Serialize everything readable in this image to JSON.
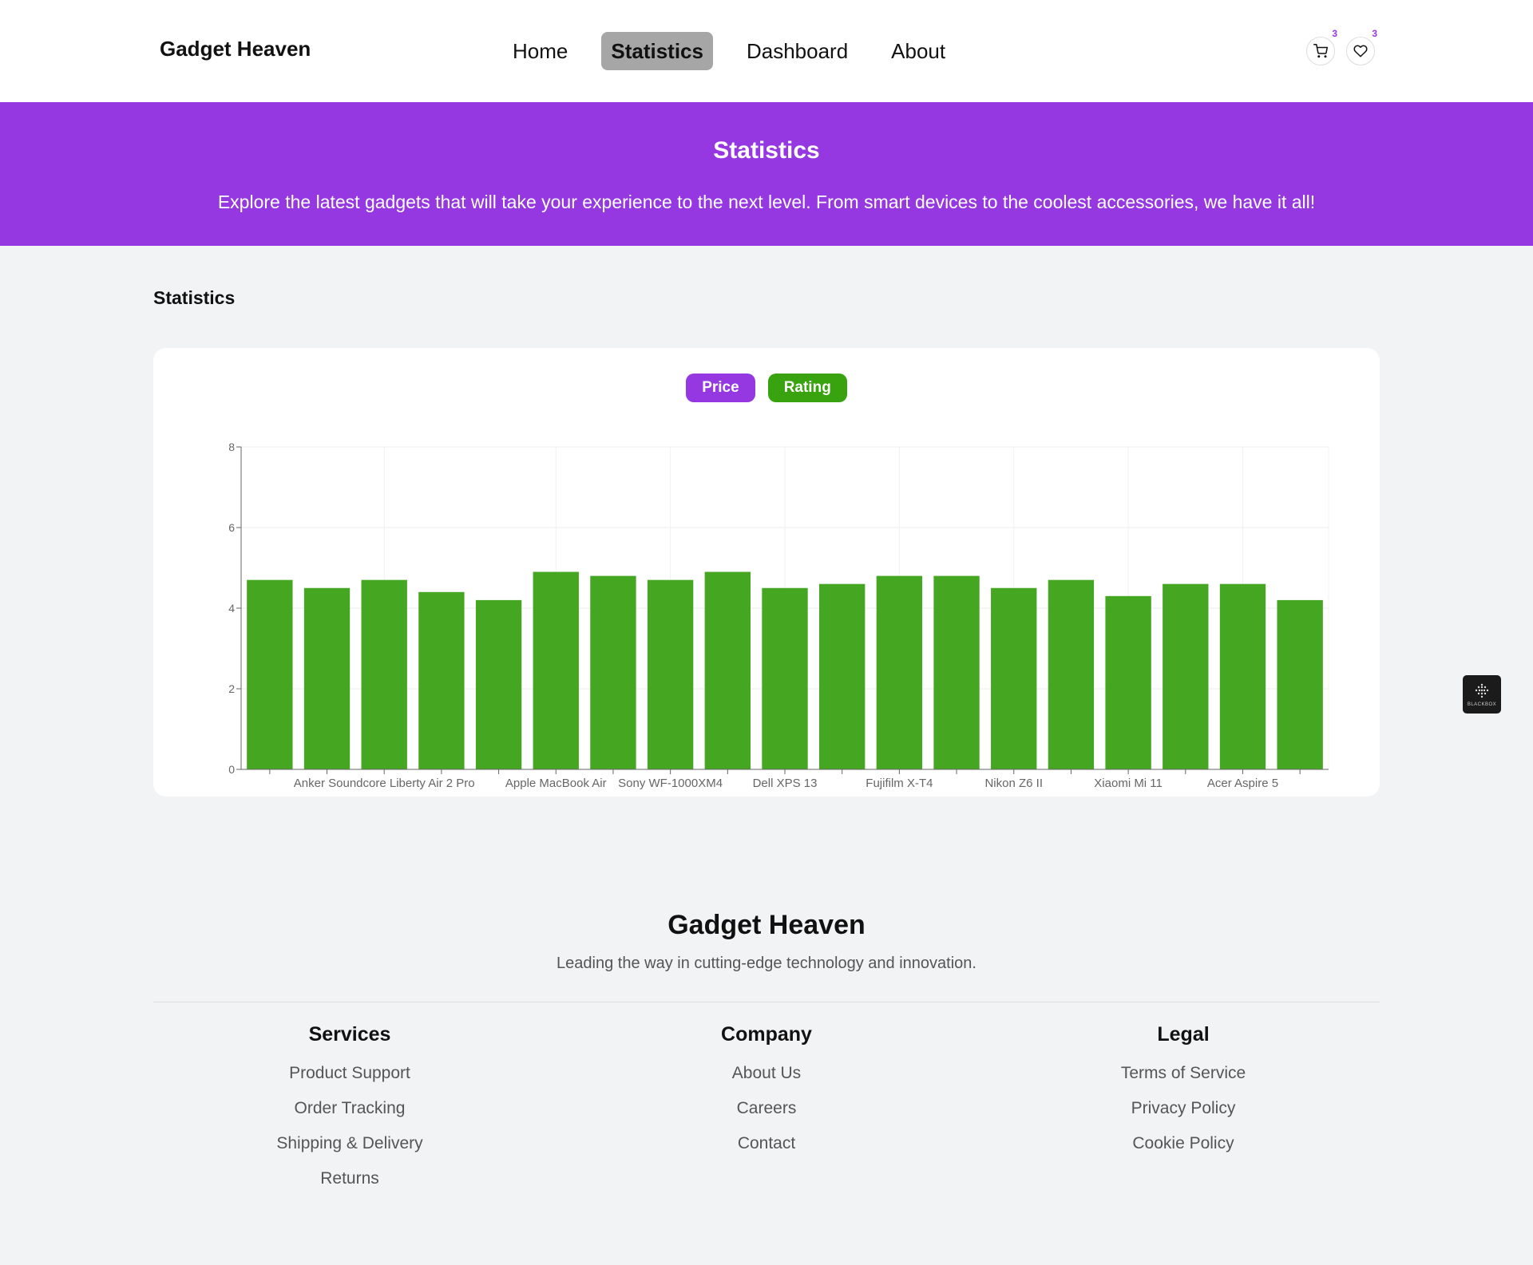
{
  "nav": {
    "brand": "Gadget Heaven",
    "links": [
      "Home",
      "Statistics",
      "Dashboard",
      "About"
    ],
    "active": "Statistics",
    "cart_count": "3",
    "wishlist_count": "3"
  },
  "banner": {
    "title": "Statistics",
    "description": "Explore the latest gadgets that will take your experience to the next level. From smart devices to the coolest accessories, we have it all!"
  },
  "section": {
    "title": "Statistics"
  },
  "toggles": {
    "price": "Price",
    "rating": "Rating"
  },
  "colors": {
    "brand": "#9538e2",
    "rating_bar": "#44a621",
    "rating_button": "#38a30f"
  },
  "chart_data": {
    "type": "bar",
    "categories": [
      "",
      "",
      "Anker Soundcore Liberty Air 2 Pro",
      "",
      "",
      "Apple MacBook Air",
      "",
      "Sony WF-1000XM4",
      "",
      "Dell XPS 13",
      "",
      "Fujifilm X-T4",
      "",
      "Nikon Z6 II",
      "",
      "Xiaomi Mi 11",
      "",
      "Acer Aspire 5",
      ""
    ],
    "series": [
      {
        "name": "rating",
        "values": [
          4.7,
          4.5,
          4.7,
          4.4,
          4.2,
          4.9,
          4.8,
          4.7,
          4.9,
          4.5,
          4.6,
          4.8,
          4.8,
          4.5,
          4.7,
          4.3,
          4.6,
          4.6,
          4.2
        ]
      }
    ],
    "ylim": [
      0,
      8
    ],
    "yticks": [
      0,
      2,
      4,
      6,
      8
    ],
    "legend": "bottom",
    "grid": true
  },
  "footer": {
    "brand": "Gadget Heaven",
    "tagline": "Leading the way in cutting-edge technology and innovation.",
    "columns": [
      {
        "title": "Services",
        "links": [
          "Product Support",
          "Order Tracking",
          "Shipping & Delivery",
          "Returns"
        ]
      },
      {
        "title": "Company",
        "links": [
          "About Us",
          "Careers",
          "Contact"
        ]
      },
      {
        "title": "Legal",
        "links": [
          "Terms of Service",
          "Privacy Policy",
          "Cookie Policy"
        ]
      }
    ]
  },
  "widget": {
    "label": "BLACKBOX"
  }
}
